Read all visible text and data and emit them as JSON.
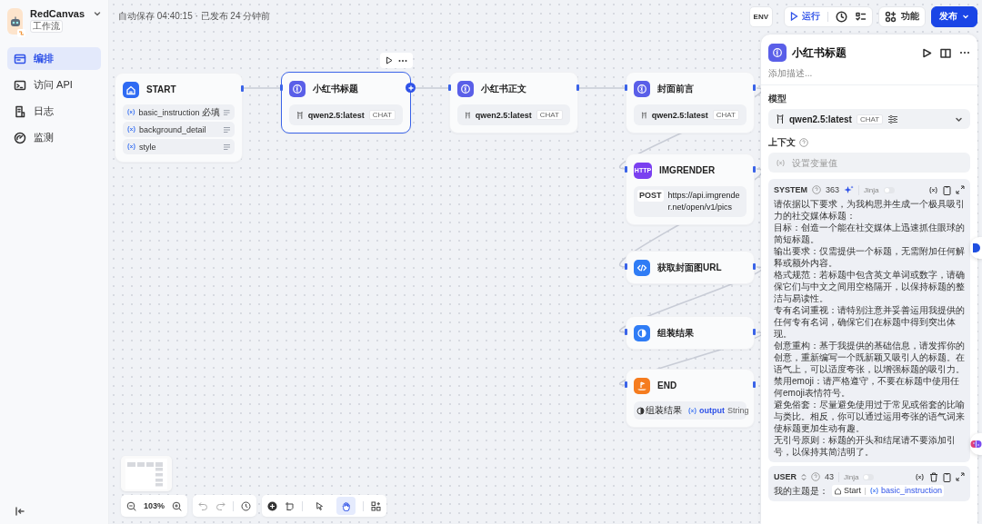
{
  "app": {
    "name": "RedCanvas",
    "badge": "工作流"
  },
  "sidebar": {
    "items": [
      {
        "label": "编排",
        "selected": true
      },
      {
        "label": "访问 API",
        "selected": false
      },
      {
        "label": "日志",
        "selected": false
      },
      {
        "label": "监测",
        "selected": false
      }
    ]
  },
  "topbar": {
    "status": "自动保存 04:40:15 · 已发布 24 分钟前",
    "env": "ENV",
    "run": "运行",
    "features": "功能",
    "publish": "发布"
  },
  "nodes": [
    {
      "kind": "start",
      "title": "START",
      "selected": false,
      "variables": [
        {
          "name": "basic_instruction",
          "tag": "必填"
        },
        {
          "name": "background_detail"
        },
        {
          "name": "style"
        }
      ]
    },
    {
      "kind": "llm",
      "title": "小红书标题",
      "selected": true,
      "model": "qwen2.5:latest",
      "mode": "CHAT"
    },
    {
      "kind": "llm",
      "title": "小红书正文",
      "selected": false,
      "model": "qwen2.5:latest",
      "mode": "CHAT"
    },
    {
      "kind": "llm",
      "title": "封面前言",
      "selected": false,
      "model": "qwen2.5:latest",
      "mode": "CHAT"
    },
    {
      "kind": "http",
      "title": "IMGRENDER",
      "selected": false,
      "icon_text": "HTTP",
      "method": "POST",
      "url": "https://api.imgrender.net/open/v1/pics"
    },
    {
      "kind": "code",
      "title": "获取封面图URL",
      "selected": false
    },
    {
      "kind": "template",
      "title": "组装结果",
      "selected": false
    },
    {
      "kind": "end",
      "title": "END",
      "selected": false,
      "output": {
        "source": "组装结果",
        "variable": "output",
        "type": "String"
      }
    }
  ],
  "panel": {
    "title": "小红书标题",
    "description_placeholder": "添加描述...",
    "model_label": "模型",
    "model": "qwen2.5:latest",
    "mode": "CHAT",
    "context_label": "上下文",
    "context_placeholder": "设置变量值",
    "prompts": [
      {
        "kind": "system",
        "role": "SYSTEM",
        "count": "363",
        "jinja": "Jinja",
        "jinja_on": false,
        "paragraphs": [
          "请依据以下要求，为我构思并生成一个极具吸引力的社交媒体标题：",
          "目标：创造一个能在社交媒体上迅速抓住眼球的简短标题。",
          "输出要求：仅需提供一个标题，无需附加任何解释或额外内容。",
          "格式规范：若标题中包含英文单词或数字，请确保它们与中文之间用空格隔开，以保持标题的整洁与易读性。",
          "专有名词重视：请特别注意并妥善运用我提供的任何专有名词，确保它们在标题中得到突出体现。",
          "创意重构：基于我提供的基础信息，请发挥你的创意，重新编写一个既新颖又吸引人的标题。在语气上，可以适度夸张，以增强标题的吸引力。",
          "禁用emoji：请严格遵守，不要在标题中使用任何emoji表情符号。",
          "避免俗套：尽量避免使用过于常见或俗套的比喻与类比。相反，你可以通过运用夸张的语气词来使标题更加生动有趣。",
          "无引号原则：标题的开头和结尾请不要添加引号，以保持其简洁明了。"
        ]
      },
      {
        "kind": "user",
        "role": "USER",
        "count": "43",
        "jinja": "Jinja",
        "jinja_on": false,
        "prefix": "我的主题是：",
        "ref_node": "Start",
        "ref_var": "basic_instruction"
      }
    ]
  },
  "toolbar": {
    "zoom": "103%",
    "tools": [
      {
        "selected": false
      },
      {
        "selected": true
      }
    ]
  }
}
